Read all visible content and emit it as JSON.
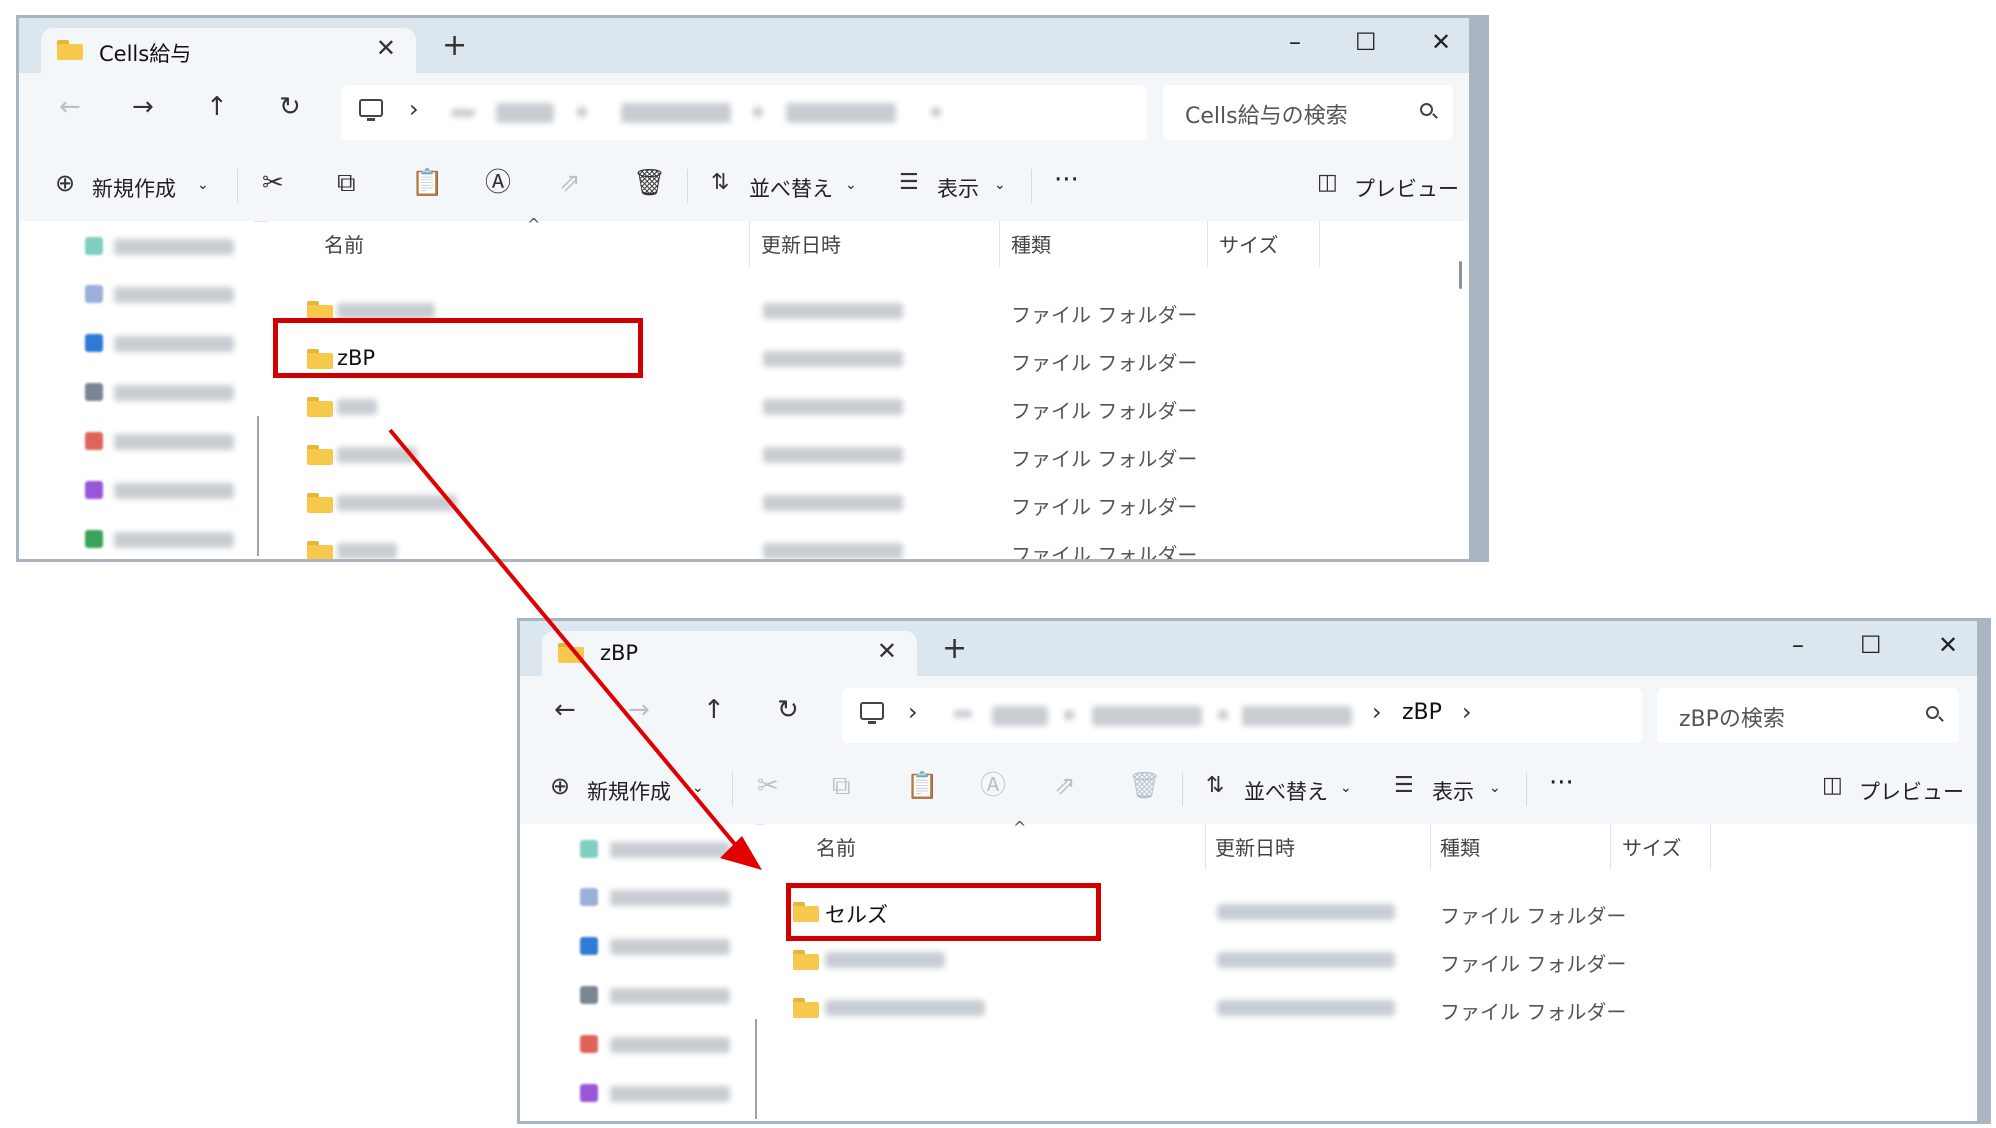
{
  "window1": {
    "tab_title": "Cells給与",
    "tab_close": "✕",
    "tab_add": "+",
    "min": "–",
    "max": "☐",
    "close": "✕",
    "search_placeholder": "Cells給与の検索",
    "cmd": {
      "new": "新規作成",
      "sort": "並べ替え",
      "view": "表示",
      "more": "···",
      "preview": "プレビュー"
    },
    "columns": {
      "name": "名前",
      "modified": "更新日時",
      "type": "種類",
      "size": "サイズ"
    },
    "rows": [
      {
        "name": "",
        "type": "ファイル フォルダー"
      },
      {
        "name": "zBP",
        "type": "ファイル フォルダー"
      },
      {
        "name": "",
        "type": "ファイル フォルダー"
      },
      {
        "name": "",
        "type": "ファイル フォルダー"
      },
      {
        "name": "",
        "type": "ファイル フォルダー"
      },
      {
        "name": "",
        "type": "ファイル フォルダー"
      }
    ]
  },
  "window2": {
    "tab_title": "zBP",
    "tab_close": "✕",
    "tab_add": "+",
    "min": "–",
    "max": "☐",
    "close": "✕",
    "breadcrumb_current": "zBP",
    "search_placeholder": "zBPの検索",
    "cmd": {
      "new": "新規作成",
      "sort": "並べ替え",
      "view": "表示",
      "more": "···",
      "preview": "プレビュー"
    },
    "columns": {
      "name": "名前",
      "modified": "更新日時",
      "type": "種類",
      "size": "サイズ"
    },
    "rows": [
      {
        "name": "セルズ",
        "type": "ファイル フォルダー"
      },
      {
        "name": "",
        "type": "ファイル フォルダー"
      },
      {
        "name": "",
        "type": "ファイル フォルダー"
      }
    ]
  },
  "colors": {
    "highlight": "#d00000",
    "arrow": "#e00000",
    "folder": "#f6c94d",
    "titlebar": "#dce6ee"
  }
}
